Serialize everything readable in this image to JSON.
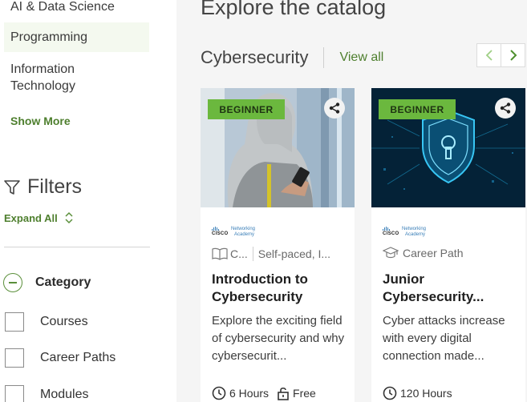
{
  "sidebar": {
    "topics": [
      {
        "label": "AI & Data Science",
        "active": false
      },
      {
        "label": "Programming",
        "active": true
      },
      {
        "label": "Information Technology",
        "active": false
      }
    ],
    "show_more": "Show More",
    "filters_label": "Filters",
    "expand_all": "Expand All",
    "category_label": "Category",
    "category_options": [
      "Courses",
      "Career Paths",
      "Modules"
    ]
  },
  "main": {
    "page_title": "Explore the catalog",
    "section_title": "Cybersecurity",
    "view_all": "View all",
    "cards": [
      {
        "badge": "BEGINNER",
        "org_name": "CISCO",
        "org_sub_1": "Networking",
        "org_sub_2": "Academy",
        "meta_type": "C...",
        "meta_extra": "Self-paced, I...",
        "title": "Introduction to Cybersecurity",
        "description": "Explore the exciting field of cybersecurity and why cybersecurit...",
        "duration": "6 Hours",
        "price": "Free"
      },
      {
        "badge": "BEGINNER",
        "org_name": "CISCO",
        "org_sub_1": "Networking",
        "org_sub_2": "Academy",
        "meta_type": "Career Path",
        "title": "Junior Cybersecurity...",
        "description": "Cyber attacks increase with every digital connection made...",
        "duration": "120 Hours"
      }
    ]
  },
  "colors": {
    "accent_green": "#4e7f2e",
    "badge_green": "#6bb83e",
    "main_bg": "#f5f5f5"
  },
  "icons": [
    "filter-icon",
    "chevron-up-down-icon",
    "minus-circle-icon",
    "chevron-left-icon",
    "chevron-right-icon",
    "share-icon",
    "book-icon",
    "graduation-cap-icon",
    "clock-icon",
    "lock-icon"
  ]
}
